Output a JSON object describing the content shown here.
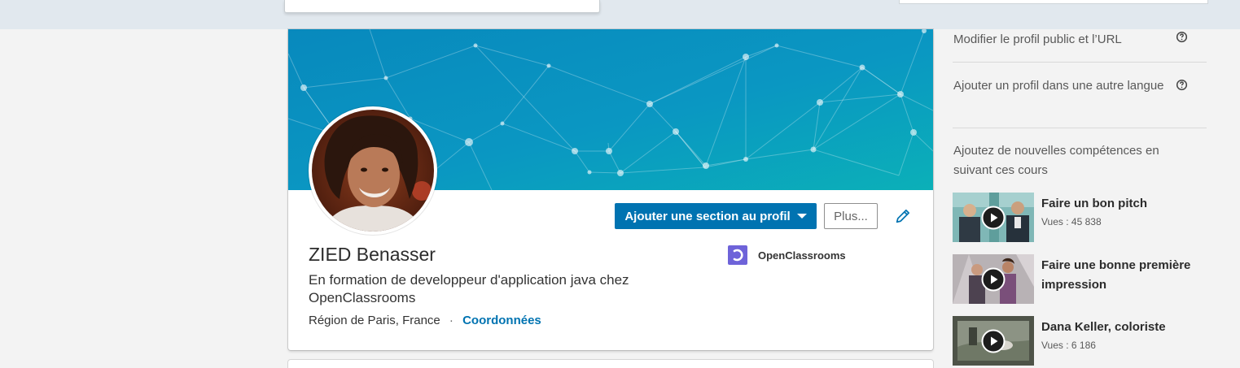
{
  "profile": {
    "name": "ZIED Benasser",
    "headline": "En formation de developpeur d'application java chez OpenClassrooms",
    "location": "Région de Paris, France",
    "separator": "·",
    "contact_link": "Coordonnées",
    "company": "OpenClassrooms",
    "actions": {
      "add_section_label": "Ajouter une section au profil",
      "more_label": "Plus..."
    }
  },
  "right_rail": {
    "links": [
      {
        "label": "Modifier le profil public et l’URL",
        "icon": "help-circle-icon"
      },
      {
        "label": "Ajouter un profil dans une autre langue",
        "icon": "help-circle-icon"
      }
    ],
    "courses_title": "Ajoutez de nouvelles compétences en suivant ces cours",
    "courses": [
      {
        "title": "Faire un bon pitch",
        "views": "Vues : 45 838"
      },
      {
        "title": "Faire une bonne première impression",
        "views": ""
      },
      {
        "title": "Dana Keller, coloriste",
        "views": "Vues : 6 186"
      }
    ]
  },
  "colors": {
    "primary": "#0073b1",
    "banner": "#0a95c3",
    "company_logo": "#6e63d9",
    "background": "#f3f3f3",
    "topbar": "#e1e8ee"
  }
}
